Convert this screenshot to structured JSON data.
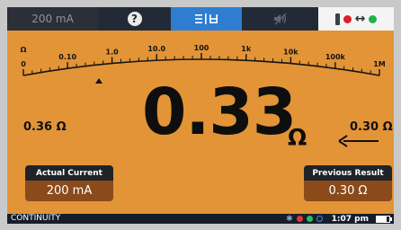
{
  "topbar": {
    "test_current": "200 mA",
    "help_icon": "question-icon",
    "range_icon": "range-toggle-icon",
    "mute_icon": "mute-icon",
    "leads_icon": "test-leads-icon"
  },
  "scale": {
    "unit_label": "Ω",
    "ticks": [
      "0",
      "0.10",
      "1.0",
      "10.0",
      "100",
      "1k",
      "10k",
      "100k",
      "1M"
    ]
  },
  "reading": {
    "value": "0.33",
    "unit": "Ω",
    "left_value": "0.36 Ω",
    "right_value": "0.30 Ω"
  },
  "actual_current": {
    "label": "Actual Current",
    "value": "200 mA"
  },
  "previous_result": {
    "label": "Previous Result",
    "value": "0.30 Ω"
  },
  "status": {
    "mode": "CONTINUITY",
    "time": "1:07 pm",
    "battery_level": 0.75
  },
  "colors": {
    "screen_bg": "#e39436",
    "accent_blue": "#2e7dd0",
    "value_box": "#8a4a1a"
  }
}
